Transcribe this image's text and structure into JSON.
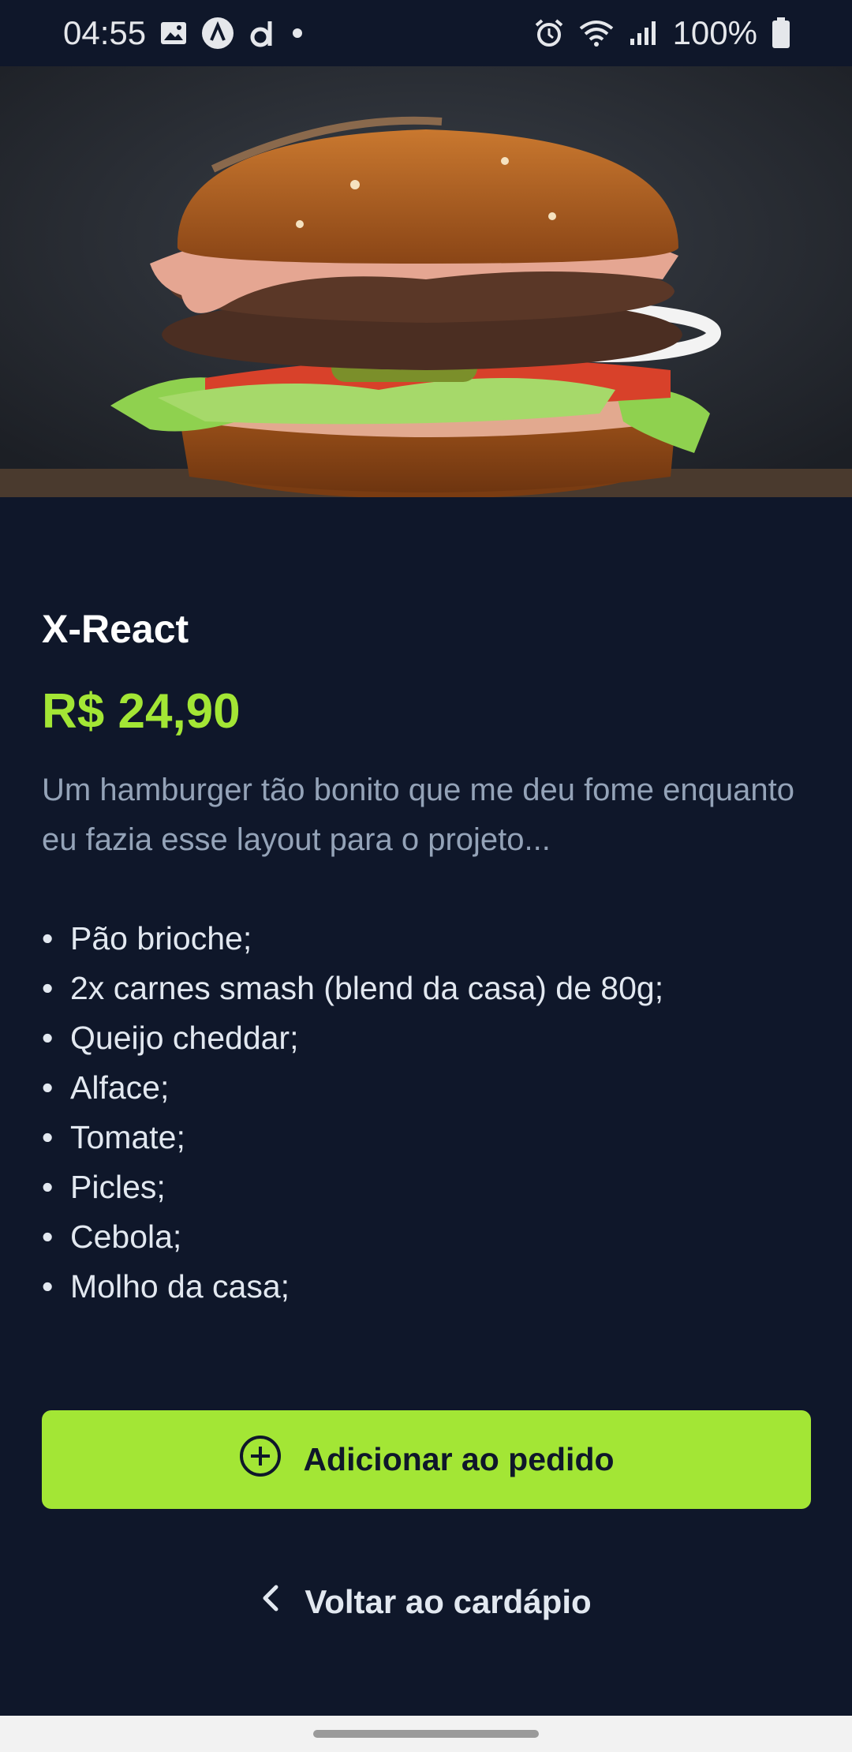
{
  "status_bar": {
    "time": "04:55",
    "battery": "100%",
    "icons": [
      "gallery-icon",
      "app-a-icon",
      "app-d-icon",
      "dot-icon",
      "alarm-icon",
      "wifi-icon",
      "signal-icon",
      "battery-icon"
    ]
  },
  "product": {
    "image_description": "hamburger",
    "title": "X-React",
    "price": "R$ 24,90",
    "description": "Um hamburger tão bonito que me deu fome enquanto eu fazia esse layout para o projeto...",
    "bullet": "•",
    "ingredients": [
      "Pão brioche;",
      "2x carnes smash (blend da casa) de 80g;",
      "Queijo cheddar;",
      "Alface;",
      "Tomate;",
      "Picles;",
      "Cebola;",
      "Molho da casa;"
    ]
  },
  "actions": {
    "add_label": "Adicionar ao pedido",
    "add_icon": "plus-circle-icon",
    "back_label": "Voltar ao cardápio",
    "back_icon": "chevron-left-icon"
  },
  "colors": {
    "background": "#0f172a",
    "accent": "#a3e635",
    "text_muted": "#94a3b8",
    "text": "#e2e8f0"
  }
}
